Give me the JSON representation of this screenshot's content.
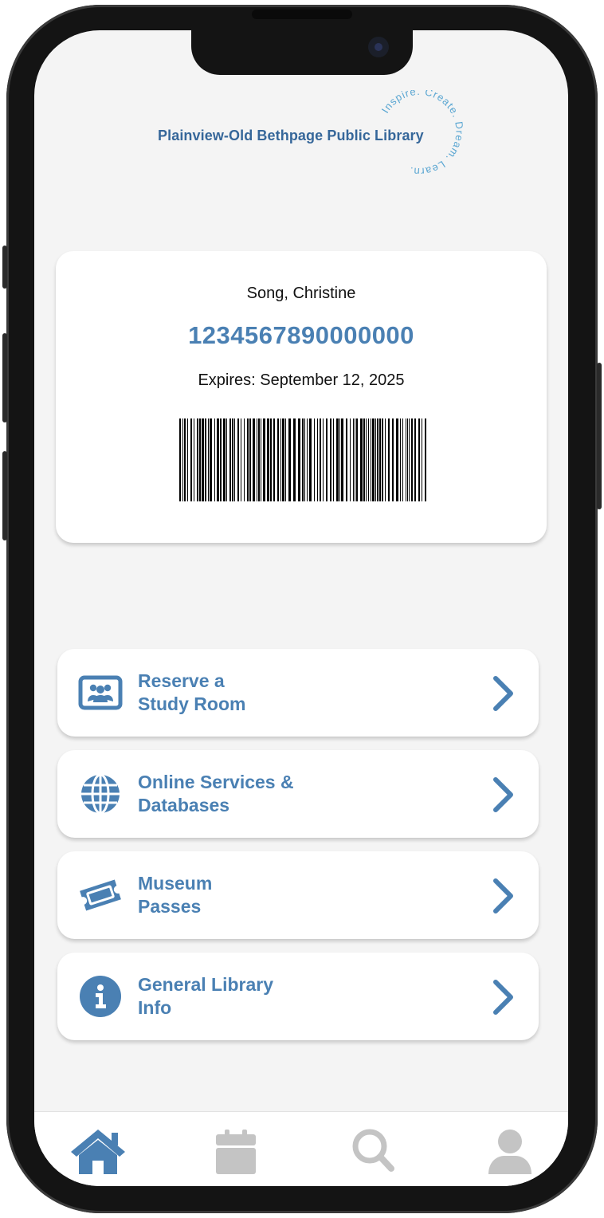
{
  "library": {
    "name": "Plainview-Old Bethpage Public Library",
    "tagline": "Inspire. Create. Dream. Learn."
  },
  "card": {
    "patron_name": "Song, Christine",
    "number": "1234567890000000",
    "expires": "Expires: September 12, 2025"
  },
  "menu": [
    {
      "label": "Reserve a\nStudy Room",
      "icon": "study-room-icon"
    },
    {
      "label": "Online Services &\nDatabases",
      "icon": "globe-icon"
    },
    {
      "label": "Museum\nPasses",
      "icon": "ticket-icon"
    },
    {
      "label": "General Library\nInfo",
      "icon": "info-icon"
    }
  ],
  "tabs": [
    {
      "name": "home",
      "icon": "home-icon",
      "active": true
    },
    {
      "name": "calendar",
      "icon": "calendar-icon",
      "active": false
    },
    {
      "name": "search",
      "icon": "search-icon",
      "active": false
    },
    {
      "name": "profile",
      "icon": "user-icon",
      "active": false
    }
  ],
  "colors": {
    "accent": "#4a80b3",
    "logo": "#36679a",
    "inactive": "#c4c4c4",
    "background": "#f4f4f4"
  }
}
